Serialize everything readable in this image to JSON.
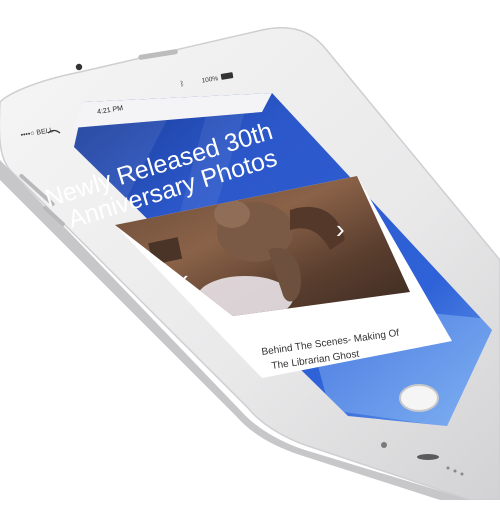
{
  "status_bar": {
    "carrier": "••••○ BELL",
    "wifi_icon": "wifi-icon",
    "time": "4:21 PM",
    "battery_percent": "100%",
    "battery_icon": "battery-icon",
    "bluetooth_icon": "bluetooth-icon"
  },
  "page": {
    "title_line1": "Newly Released 30th",
    "title_line2": "Anniversary Photos"
  },
  "carousel": {
    "caption_line1": "Behind The Scenes- Making Of",
    "caption_line2": "The Librarian Ghost",
    "prev_icon": "chevron-left-icon",
    "next_icon": "chevron-right-icon"
  },
  "device": {
    "home_button_icon": "home-button-icon",
    "speaker_icon": "speaker-grille-icon",
    "camera_icon": "front-camera-icon"
  },
  "colors": {
    "background_blue": "#2e56c8",
    "background_dark": "#1a2f7a",
    "card_bg": "#ffffff",
    "caption_text": "#333333",
    "title_text": "#ffffff"
  }
}
